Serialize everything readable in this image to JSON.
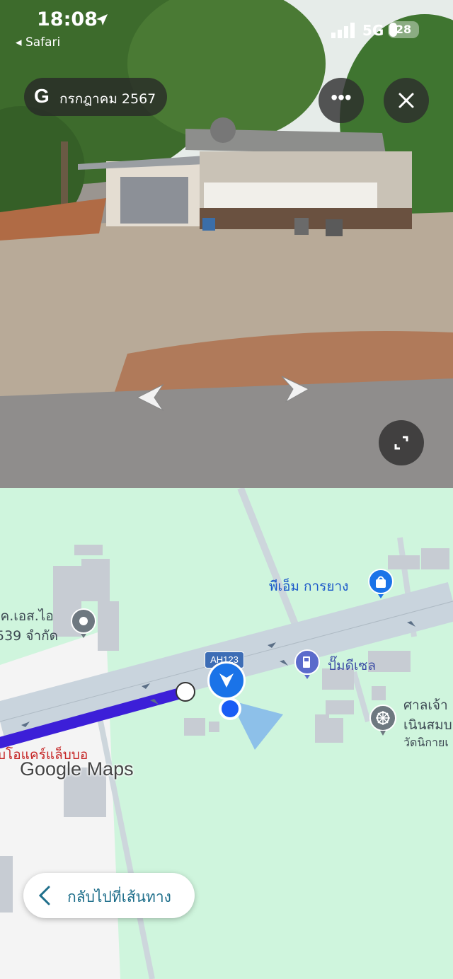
{
  "status_bar": {
    "time": "18:08",
    "back_app": "Safari",
    "network": "5G",
    "battery_level": "28",
    "battery_fraction": 0.28
  },
  "street_view": {
    "date_label": "กรกฎาคม 2567",
    "provider_glyph": "G",
    "more_icon": "more-icon",
    "close_icon": "close-icon",
    "expand_icon": "expand-icon"
  },
  "map": {
    "brand": "Google Maps",
    "route_shield": "AH123",
    "places": [
      {
        "name": "พีเอ็ม การยาง",
        "icon": "shopping-bag-icon"
      },
      {
        "name": "ปั๊มดีเซล",
        "icon": "fuel-icon"
      },
      {
        "name": "ศาลเจ้า",
        "icon": "wheel-icon"
      },
      {
        "name": "เนินสมบ",
        "icon": ""
      },
      {
        "name": "วัดนิกายเ",
        "icon": ""
      },
      {
        "name": "เค.เอส.ไอ",
        "icon": "pin-icon"
      },
      {
        "name": "539 จำกัด",
        "icon": ""
      },
      {
        "name": "บโอแคร์แล็บบอ",
        "icon": ""
      }
    ],
    "back_to_route": "กลับไปที่เส้นทาง"
  },
  "colors": {
    "route": "#3c1fd8",
    "map_bg": "#cff5dd",
    "road": "#c9d4dd",
    "accent_blue": "#1a73e8"
  }
}
